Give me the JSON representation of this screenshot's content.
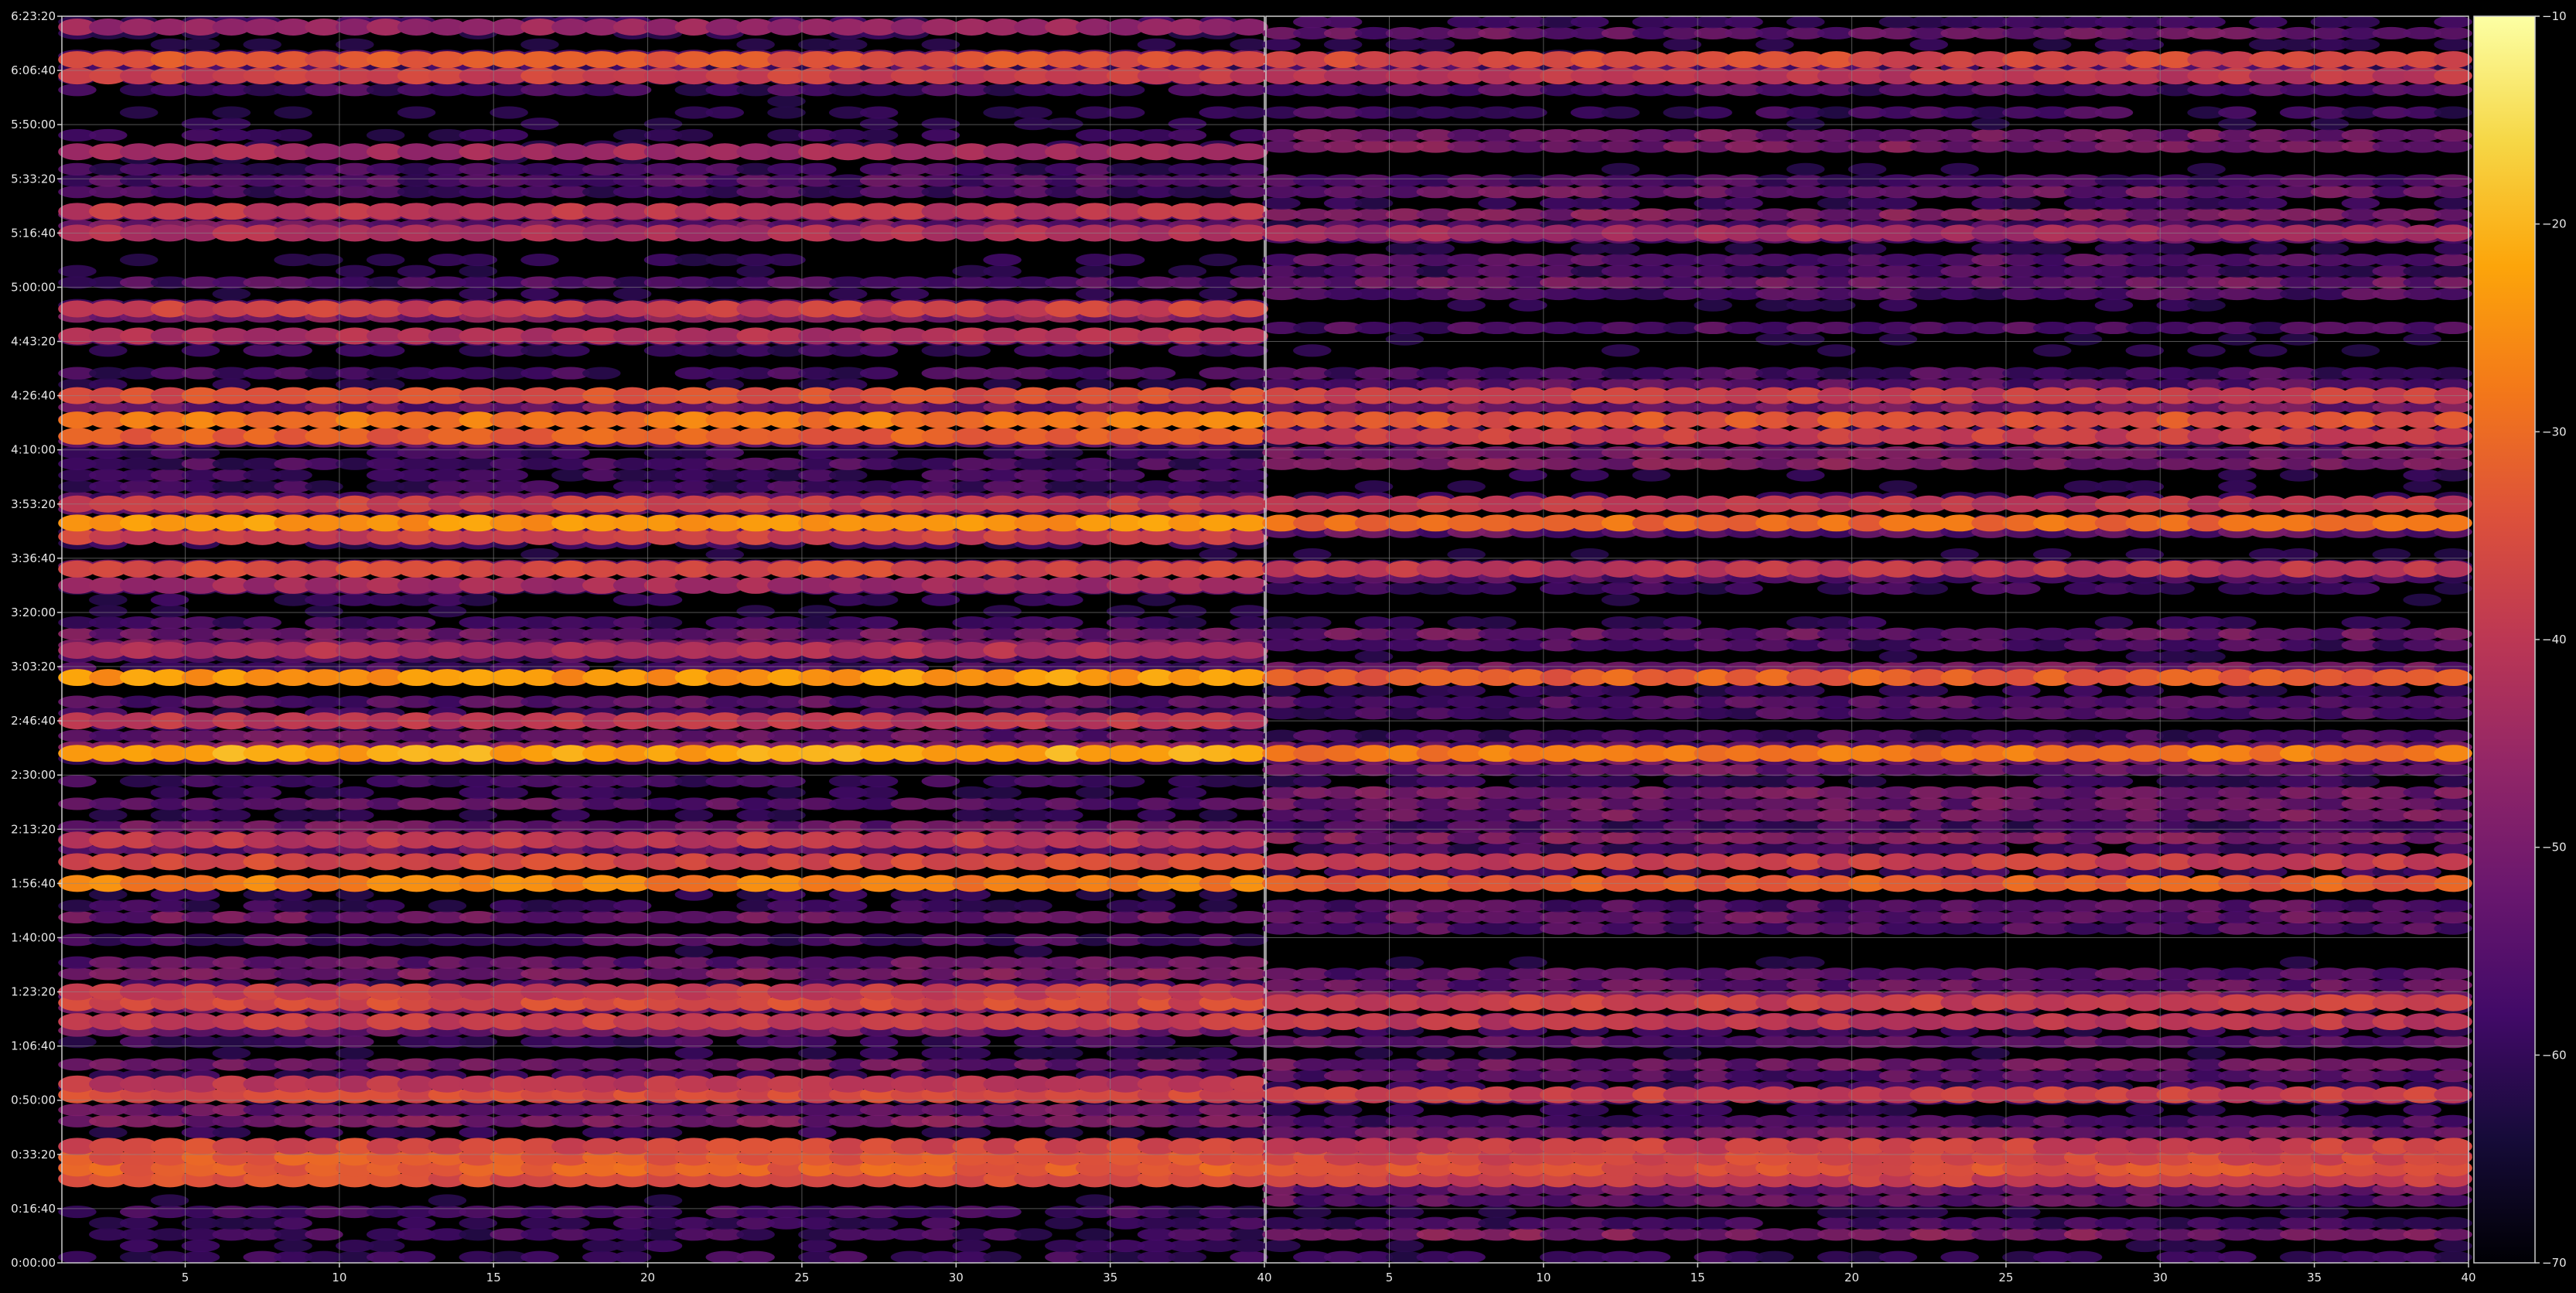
{
  "chart_data": [
    {
      "type": "heatmap",
      "title": "",
      "xlabel": "",
      "ylabel": "",
      "xlim": [
        1,
        40
      ],
      "x_ticks": [
        5,
        10,
        15,
        20,
        25,
        30,
        35,
        40
      ],
      "x_tick_labels": [
        "5",
        "10",
        "15",
        "20",
        "25",
        "30",
        "35",
        "40"
      ],
      "ylim_seconds": [
        0,
        23000
      ],
      "y_ticks_seconds": [
        0,
        1000,
        2000,
        3000,
        4000,
        5000,
        6000,
        7000,
        8000,
        9000,
        10000,
        11000,
        12000,
        13000,
        14000,
        15000,
        16000,
        17000,
        18000,
        19000,
        20000,
        21000,
        22000,
        23000
      ],
      "y_tick_labels": [
        "0:00:00",
        "0:16:40",
        "0:33:20",
        "0:50:00",
        "1:06:40",
        "1:23:20",
        "1:40:00",
        "1:56:40",
        "2:13:20",
        "2:30:00",
        "2:46:40",
        "3:03:20",
        "3:20:00",
        "3:36:40",
        "3:53:20",
        "4:10:00",
        "4:26:40",
        "4:43:20",
        "5:00:00",
        "5:16:40",
        "5:33:20",
        "5:50:00",
        "6:06:40",
        "6:23:20"
      ],
      "grid": true,
      "colormap": "inferno",
      "value_range": [
        -70,
        -10
      ],
      "bright_bands_seconds": [
        {
          "t": 1550,
          "v": -35
        },
        {
          "t": 1750,
          "v": -32
        },
        {
          "t": 1950,
          "v": -33
        },
        {
          "t": 2150,
          "v": -36
        },
        {
          "t": 3100,
          "v": -36
        },
        {
          "t": 3300,
          "v": -40
        },
        {
          "t": 4450,
          "v": -38
        },
        {
          "t": 4800,
          "v": -36
        },
        {
          "t": 5000,
          "v": -38
        },
        {
          "t": 7000,
          "v": -27
        },
        {
          "t": 7400,
          "v": -36
        },
        {
          "t": 7800,
          "v": -40
        },
        {
          "t": 9400,
          "v": -22
        },
        {
          "t": 10000,
          "v": -40
        },
        {
          "t": 10800,
          "v": -24
        },
        {
          "t": 11300,
          "v": -42
        },
        {
          "t": 12500,
          "v": -44
        },
        {
          "t": 12800,
          "v": -36
        },
        {
          "t": 13400,
          "v": -38
        },
        {
          "t": 13650,
          "v": -24
        },
        {
          "t": 14000,
          "v": -38
        },
        {
          "t": 15250,
          "v": -32
        },
        {
          "t": 15550,
          "v": -28
        },
        {
          "t": 16000,
          "v": -35
        },
        {
          "t": 17100,
          "v": -42
        },
        {
          "t": 17600,
          "v": -38
        },
        {
          "t": 19000,
          "v": -42
        },
        {
          "t": 19400,
          "v": -40
        },
        {
          "t": 20500,
          "v": -44
        },
        {
          "t": 21900,
          "v": -38
        },
        {
          "t": 22200,
          "v": -34
        },
        {
          "t": 22800,
          "v": -45
        }
      ]
    },
    {
      "type": "heatmap",
      "title": "",
      "xlabel": "",
      "ylabel": "",
      "xlim": [
        1,
        40
      ],
      "x_ticks": [
        5,
        10,
        15,
        20,
        25,
        30,
        35,
        40
      ],
      "x_tick_labels": [
        "5",
        "10",
        "15",
        "20",
        "25",
        "30",
        "35",
        "40"
      ],
      "ylim_seconds": [
        0,
        23000
      ],
      "grid": true,
      "colormap": "inferno",
      "value_range": [
        -70,
        -10
      ],
      "bright_bands_seconds": [
        {
          "t": 1550,
          "v": -38
        },
        {
          "t": 1750,
          "v": -34
        },
        {
          "t": 1950,
          "v": -36
        },
        {
          "t": 2150,
          "v": -38
        },
        {
          "t": 3100,
          "v": -38
        },
        {
          "t": 4450,
          "v": -40
        },
        {
          "t": 4800,
          "v": -38
        },
        {
          "t": 7000,
          "v": -32
        },
        {
          "t": 7400,
          "v": -38
        },
        {
          "t": 9400,
          "v": -28
        },
        {
          "t": 10800,
          "v": -32
        },
        {
          "t": 12800,
          "v": -40
        },
        {
          "t": 13650,
          "v": -30
        },
        {
          "t": 14000,
          "v": -40
        },
        {
          "t": 15250,
          "v": -38
        },
        {
          "t": 15550,
          "v": -34
        },
        {
          "t": 16000,
          "v": -38
        },
        {
          "t": 19000,
          "v": -44
        },
        {
          "t": 21900,
          "v": -40
        },
        {
          "t": 22200,
          "v": -36
        }
      ]
    }
  ],
  "colorbar": {
    "colormap": "inferno",
    "range": [
      -70,
      -10
    ],
    "ticks": [
      -70,
      -60,
      -50,
      -40,
      -30,
      -20,
      -10
    ],
    "tick_labels": [
      "−70",
      "−60",
      "−50",
      "−40",
      "−30",
      "−20",
      "−10"
    ]
  },
  "style": {
    "background": "#000000",
    "axis_color": "#cccccc",
    "grid_color": "#8a8a8a",
    "text_color": "#e6e6e6"
  }
}
